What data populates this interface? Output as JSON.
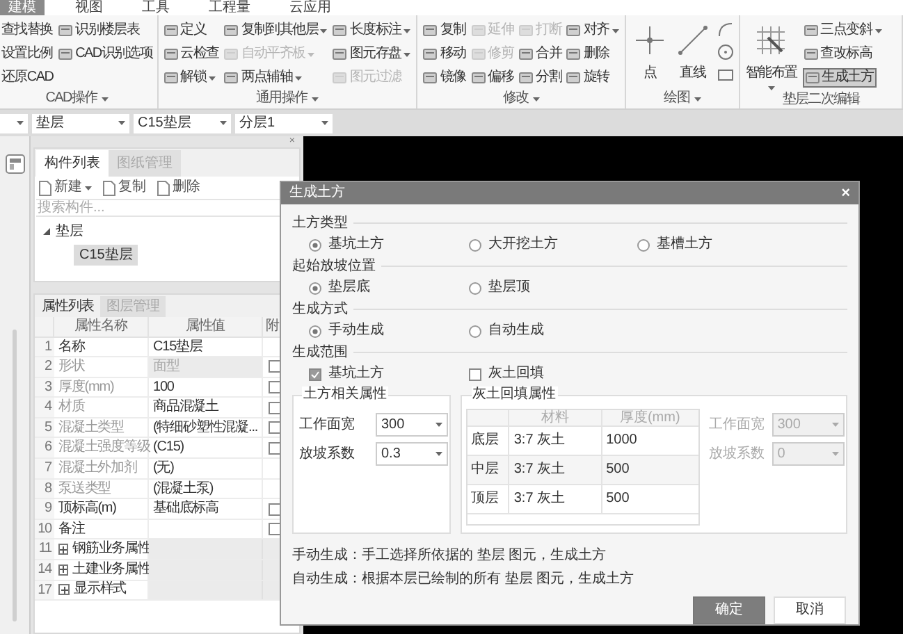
{
  "menu_tabs": [
    {
      "label": "建模",
      "selected": true
    },
    {
      "label": "视图",
      "selected": false
    },
    {
      "label": "工具",
      "selected": false
    },
    {
      "label": "工程量",
      "selected": false
    },
    {
      "label": "云应用",
      "selected": false
    }
  ],
  "ribbon_groups": [
    {
      "title": "CAD操作",
      "dropdown": true,
      "columns": [
        [
          {
            "label": "查找替换",
            "kind": "text",
            "disabled": false,
            "dropdown": false
          },
          {
            "label": "设置比例",
            "kind": "text",
            "disabled": false,
            "dropdown": false
          },
          {
            "label": "还原CAD",
            "kind": "text",
            "disabled": false,
            "dropdown": false
          }
        ],
        [
          {
            "label": "识别楼层表",
            "kind": "small",
            "disabled": false,
            "dropdown": false
          },
          {
            "label": "CAD识别选项",
            "kind": "small",
            "disabled": false,
            "dropdown": false
          }
        ]
      ]
    },
    {
      "title": "通用操作",
      "dropdown": true,
      "columns": [
        [
          {
            "label": "定义",
            "kind": "small",
            "disabled": false,
            "dropdown": false
          },
          {
            "label": "云检查",
            "kind": "small",
            "disabled": false,
            "dropdown": false
          },
          {
            "label": "解锁",
            "kind": "small",
            "disabled": false,
            "dropdown": true
          }
        ],
        [
          {
            "label": "复制到其他层",
            "kind": "small",
            "disabled": false,
            "dropdown": true
          },
          {
            "label": "自动平齐板",
            "kind": "small",
            "disabled": true,
            "dropdown": true
          },
          {
            "label": "两点辅轴",
            "kind": "small",
            "disabled": false,
            "dropdown": true
          }
        ],
        [
          {
            "label": "长度标注",
            "kind": "small",
            "disabled": false,
            "dropdown": true
          },
          {
            "label": "图元存盘",
            "kind": "small",
            "disabled": false,
            "dropdown": true
          },
          {
            "label": "图元过滤",
            "kind": "small",
            "disabled": true,
            "dropdown": false
          }
        ]
      ]
    },
    {
      "title": "修改",
      "dropdown": true,
      "columns": [
        [
          {
            "label": "复制",
            "kind": "small",
            "disabled": false,
            "dropdown": false
          },
          {
            "label": "移动",
            "kind": "small",
            "disabled": false,
            "dropdown": false
          },
          {
            "label": "镜像",
            "kind": "small",
            "disabled": false,
            "dropdown": false
          }
        ],
        [
          {
            "label": "延伸",
            "kind": "small",
            "disabled": true,
            "dropdown": false
          },
          {
            "label": "修剪",
            "kind": "small",
            "disabled": true,
            "dropdown": false
          },
          {
            "label": "偏移",
            "kind": "small",
            "disabled": false,
            "dropdown": false
          }
        ],
        [
          {
            "label": "打断",
            "kind": "small",
            "disabled": true,
            "dropdown": false
          },
          {
            "label": "合并",
            "kind": "small",
            "disabled": false,
            "dropdown": false
          },
          {
            "label": "分割",
            "kind": "small",
            "disabled": false,
            "dropdown": false
          }
        ],
        [
          {
            "label": "对齐",
            "kind": "small",
            "disabled": false,
            "dropdown": true
          },
          {
            "label": "删除",
            "kind": "small",
            "disabled": false,
            "dropdown": false
          },
          {
            "label": "旋转",
            "kind": "small",
            "disabled": false,
            "dropdown": false
          }
        ]
      ]
    },
    {
      "title": "绘图",
      "dropdown": true,
      "columns": [
        [
          {
            "label": "点",
            "kind": "point",
            "disabled": false,
            "dropdown": false
          }
        ],
        [
          {
            "label": "直线",
            "kind": "line",
            "disabled": false,
            "dropdown": false
          }
        ],
        [
          {
            "kind": "arc",
            "disabled": false,
            "dropdown": false
          },
          {
            "kind": "circle",
            "disabled": false,
            "dropdown": false
          },
          {
            "kind": "rect",
            "disabled": false,
            "dropdown": false
          }
        ]
      ]
    },
    {
      "title": "垫层二次编辑",
      "dropdown": false,
      "columns": [
        [
          {
            "label": "智能布置",
            "kind": "grid",
            "disabled": false,
            "dropdown": true,
            "active": false
          }
        ],
        [
          {
            "label": "三点变斜",
            "kind": "small",
            "disabled": false,
            "dropdown": true,
            "active": false
          },
          {
            "label": "查改标高",
            "kind": "small",
            "disabled": false,
            "dropdown": false,
            "active": false
          },
          {
            "label": "生成土方",
            "kind": "small",
            "disabled": false,
            "dropdown": false,
            "active": true
          }
        ]
      ]
    }
  ],
  "selectors": [
    {
      "value": "垫层"
    },
    {
      "value": "C15垫层"
    },
    {
      "value": "分层1"
    }
  ],
  "component_panel": {
    "close": "×",
    "tabs": [
      {
        "label": "构件列表",
        "selected": true
      },
      {
        "label": "图纸管理",
        "selected": false
      }
    ],
    "toolbar": [
      {
        "label": "新建",
        "dropdown": true
      },
      {
        "label": "复制",
        "dropdown": false
      },
      {
        "label": "删除",
        "dropdown": false
      }
    ],
    "search": {
      "placeholder": "搜索构件..."
    },
    "tree": [
      {
        "label": "垫层",
        "expanded": true,
        "selected": false,
        "children": [
          {
            "label": "C15垫层",
            "selected": true
          }
        ]
      }
    ]
  },
  "properties_panel": {
    "tabs": [
      {
        "label": "属性列表",
        "selected": true
      },
      {
        "label": "图层管理",
        "selected": false
      }
    ],
    "columns": [
      "属性名称",
      "属性值",
      "附"
    ],
    "rows": [
      {
        "kind": "prop",
        "num": "1",
        "name": "名称",
        "value": "C15垫层",
        "muted": false,
        "locked": false
      },
      {
        "kind": "prop",
        "num": "2",
        "name": "形状",
        "value": "面型",
        "muted": true,
        "locked": true,
        "checked": false
      },
      {
        "kind": "prop",
        "num": "3",
        "name": "厚度(mm)",
        "value": "100",
        "muted": true,
        "locked": false,
        "checked": false
      },
      {
        "kind": "prop",
        "num": "4",
        "name": "材质",
        "value": "商品混凝土",
        "muted": true,
        "locked": false,
        "checked": false
      },
      {
        "kind": "prop",
        "num": "5",
        "name": "混凝土类型",
        "value": "(特细砂塑性混凝...",
        "muted": true,
        "locked": false,
        "checked": false
      },
      {
        "kind": "prop",
        "num": "6",
        "name": "混凝土强度等级",
        "value": "(C15)",
        "muted": true,
        "locked": false,
        "checked": false
      },
      {
        "kind": "prop",
        "num": "7",
        "name": "混凝土外加剂",
        "value": "(无)",
        "muted": true,
        "locked": false
      },
      {
        "kind": "prop",
        "num": "8",
        "name": "泵送类型",
        "value": "(混凝土泵)",
        "muted": true,
        "locked": false
      },
      {
        "kind": "prop",
        "num": "9",
        "name": "顶标高(m)",
        "value": "基础底标高",
        "muted": false,
        "locked": false,
        "checked": false
      },
      {
        "kind": "prop",
        "num": "10",
        "name": "备注",
        "value": "",
        "muted": false,
        "locked": false,
        "checked": false
      },
      {
        "kind": "group",
        "num": "11",
        "name": "钢筋业务属性",
        "expanded": false
      },
      {
        "kind": "group",
        "num": "14",
        "name": "土建业务属性",
        "expanded": false
      },
      {
        "kind": "group",
        "num": "17",
        "name": "显示样式",
        "expanded": false
      }
    ]
  },
  "dialog": {
    "title": "生成土方",
    "close": "×",
    "sections": [
      {
        "title": "土方类型",
        "kind": "radio",
        "options": [
          {
            "label": "基坑土方",
            "selected": true
          },
          {
            "label": "大开挖土方",
            "selected": false
          },
          {
            "label": "基槽土方",
            "selected": false
          }
        ]
      },
      {
        "title": "起始放坡位置",
        "kind": "radio",
        "options": [
          {
            "label": "垫层底",
            "selected": true
          },
          {
            "label": "垫层顶",
            "selected": false
          }
        ]
      },
      {
        "title": "生成方式",
        "kind": "radio",
        "options": [
          {
            "label": "手动生成",
            "selected": true
          },
          {
            "label": "自动生成",
            "selected": false
          }
        ]
      },
      {
        "title": "生成范围",
        "kind": "check",
        "options": [
          {
            "label": "基坑土方",
            "checked": true
          },
          {
            "label": "灰土回填",
            "checked": false
          }
        ]
      }
    ],
    "earth_props": {
      "title": "土方相关属性",
      "fields": [
        {
          "label": "工作面宽",
          "value": "300",
          "disabled": false
        },
        {
          "label": "放坡系数",
          "value": "0.3",
          "disabled": false
        }
      ]
    },
    "backfill_props": {
      "title": "灰土回填属性",
      "columns": [
        "材料",
        "厚度(mm)"
      ],
      "rows": [
        {
          "layer": "底层",
          "material": "3:7 灰土",
          "thickness": "1000"
        },
        {
          "layer": "中层",
          "material": "3:7 灰土",
          "thickness": "500"
        },
        {
          "layer": "顶层",
          "material": "3:7 灰土",
          "thickness": "500"
        }
      ],
      "fields": [
        {
          "label": "工作面宽",
          "value": "300",
          "disabled": true
        },
        {
          "label": "放坡系数",
          "value": "0",
          "disabled": true
        }
      ]
    },
    "notes": [
      "手动生成：手工选择所依据的 垫层 图元，生成土方",
      "自动生成：根据本层已绘制的所有 垫层 图元，生成土方"
    ],
    "buttons": [
      {
        "label": "确定",
        "primary": true
      },
      {
        "label": "取消",
        "primary": false
      }
    ]
  }
}
